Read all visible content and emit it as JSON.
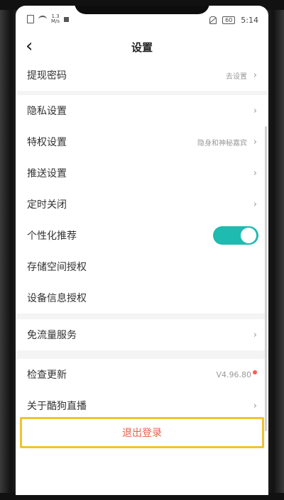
{
  "status_bar": {
    "net_speed_value": "1.3",
    "net_speed_unit": "M/s",
    "battery": "60",
    "time": "5:14"
  },
  "header": {
    "title": "设置"
  },
  "rows": [
    {
      "label": "提现密码",
      "value": "去设置"
    },
    {
      "label": "隐私设置"
    },
    {
      "label": "特权设置",
      "value": "隐身和神秘嘉宾"
    },
    {
      "label": "推送设置"
    },
    {
      "label": "定时关闭"
    },
    {
      "label": "个性化推荐",
      "toggle_on": true
    },
    {
      "label": "存储空间授权"
    },
    {
      "label": "设备信息授权"
    },
    {
      "label": "免流量服务"
    },
    {
      "label": "检查更新",
      "value": "V4.96.80"
    },
    {
      "label": "关于酷狗直播"
    }
  ],
  "logout_label": "退出登录",
  "colors": {
    "toggle_on": "#1dbbb0",
    "logout_text": "#e8604c",
    "highlight_border": "#f2c22e",
    "update_dot": "#ff5a4f"
  }
}
